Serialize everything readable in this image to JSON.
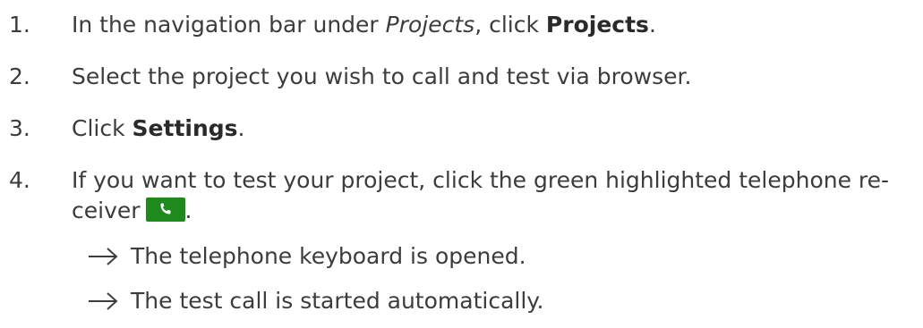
{
  "steps": [
    {
      "number": "1.",
      "pre": "In the navigation bar under ",
      "italic": "Projects",
      "mid": ", click ",
      "bold": "Projects",
      "post": "."
    },
    {
      "number": "2.",
      "text": "Select the project you wish to call and test via browser."
    },
    {
      "number": "3.",
      "pre": "Click ",
      "bold": "Settings",
      "post": "."
    },
    {
      "number": "4.",
      "line1": "If you want to test your project, click the green highlighted telephone re-",
      "line2": "ceiver",
      "post": "."
    }
  ],
  "results": [
    "The telephone keyboard is opened.",
    "The test call is started automatically."
  ],
  "icons": {
    "phone_button": "telephone-receiver-icon",
    "result_arrow": "arrow-right-icon"
  },
  "colors": {
    "phone_button_bg": "#1e8a1e",
    "text": "#3c3c3c"
  }
}
